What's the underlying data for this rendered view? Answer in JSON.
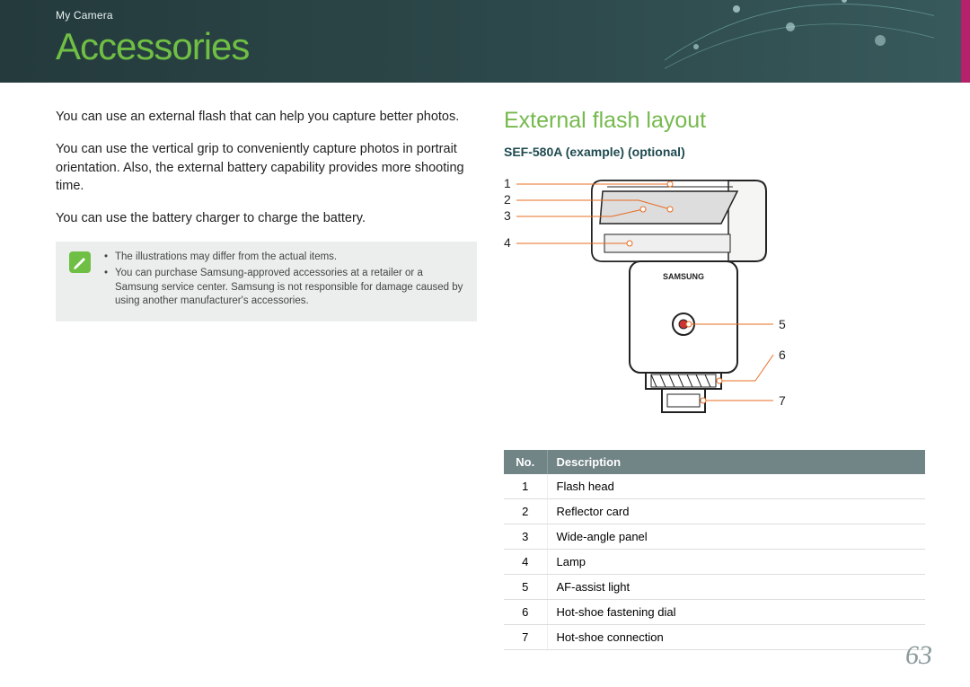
{
  "header": {
    "breadcrumb": "My Camera",
    "title": "Accessories"
  },
  "intro": {
    "p1": "You can use an external flash that can help you capture better photos.",
    "p2": "You can use the vertical grip to conveniently capture photos in portrait orientation. Also, the external battery capability provides more shooting time.",
    "p3": "You can use the battery charger to charge the battery."
  },
  "note": {
    "icon_name": "pencil-note-icon",
    "items": [
      "The illustrations may differ from the actual items.",
      "You can purchase Samsung-approved accessories at a retailer or a Samsung service center. Samsung is not responsible for damage caused by using another manufacturer's accessories."
    ]
  },
  "right": {
    "section_title": "External flash layout",
    "model_label": "SEF-580A (example) (optional)",
    "callouts": [
      "1",
      "2",
      "3",
      "4",
      "5",
      "6",
      "7"
    ],
    "brand_on_device": "SAMSUNG"
  },
  "table": {
    "headers": {
      "no": "No.",
      "desc": "Description"
    },
    "rows": [
      {
        "no": "1",
        "desc": "Flash head"
      },
      {
        "no": "2",
        "desc": "Reflector card"
      },
      {
        "no": "3",
        "desc": "Wide-angle panel"
      },
      {
        "no": "4",
        "desc": "Lamp"
      },
      {
        "no": "5",
        "desc": "AF-assist light"
      },
      {
        "no": "6",
        "desc": "Hot-shoe fastening dial"
      },
      {
        "no": "7",
        "desc": "Hot-shoe connection"
      }
    ]
  },
  "page_number": "63"
}
